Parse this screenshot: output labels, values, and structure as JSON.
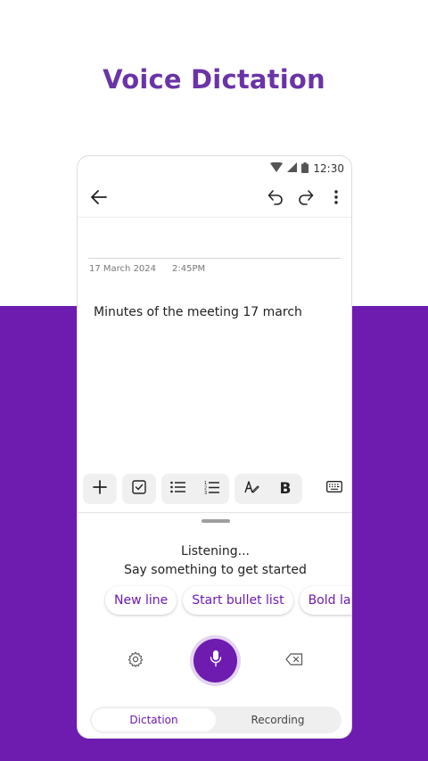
{
  "headline": "Voice Dictation",
  "status_bar": {
    "time": "12:30"
  },
  "note": {
    "date": "17 March 2024",
    "time": "2:45PM",
    "body": "Minutes of the meeting 17 march"
  },
  "dictation": {
    "status": "Listening...",
    "prompt": "Say something to get started",
    "chips": [
      "New line",
      "Start bullet list",
      "Bold last wo"
    ]
  },
  "tabs": [
    "Dictation",
    "Recording"
  ],
  "colors": {
    "accent": "#6e1bb0",
    "headline": "#6a34a6"
  },
  "icons": [
    "wifi-icon",
    "signal-icon",
    "battery-icon",
    "back-arrow-icon",
    "undo-icon",
    "redo-icon",
    "more-vert-icon",
    "add-icon",
    "checkbox-icon",
    "bullet-list-icon",
    "numbered-list-icon",
    "pen-format-icon",
    "bold-icon",
    "keyboard-icon",
    "settings-icon",
    "mic-icon",
    "backspace-icon"
  ]
}
